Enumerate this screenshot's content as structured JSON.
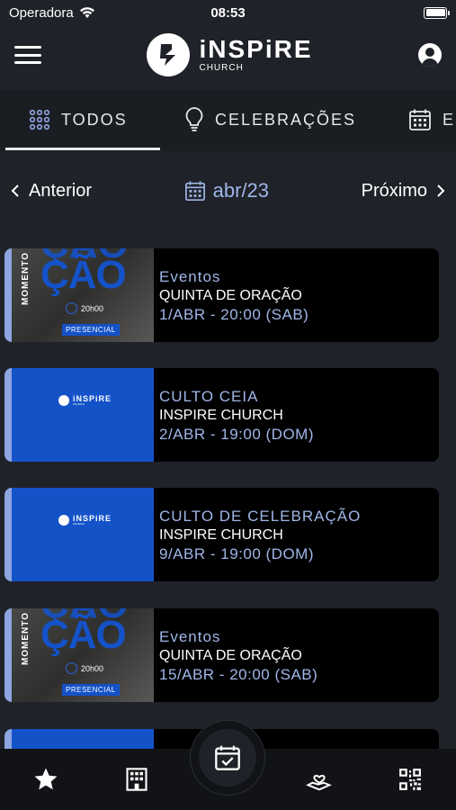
{
  "status": {
    "carrier": "Operadora",
    "time": "08:53"
  },
  "header": {
    "logo_title": "iNSPiRE",
    "logo_subtitle": "CHURCH"
  },
  "tabs": [
    {
      "label": "TODOS",
      "icon": "grid-dots-icon",
      "active": true
    },
    {
      "label": "CELEBRAÇÕES",
      "icon": "lightbulb-icon",
      "active": false
    },
    {
      "label": "E",
      "icon": "calendar-icon",
      "active": false
    }
  ],
  "month_nav": {
    "prev_label": "Anterior",
    "month": "abr/23",
    "next_label": "Próximo"
  },
  "events": [
    {
      "category": "Eventos",
      "title": "QUINTA DE ORAÇÃO",
      "date": "1/ABR - 20:00 (SAB)",
      "thumb": "photo",
      "thumb_text": {
        "big": "ÇÃO",
        "side": "MOMENTO",
        "time": "20h00",
        "badge": "PRESENCIAL"
      }
    },
    {
      "category": "CULTO CEIA",
      "title": "INSPIRE CHURCH",
      "date": "2/ABR - 19:00 (DOM)",
      "thumb": "logo",
      "thumb_text": {
        "logo_title": "iNSPiRE",
        "logo_sub": "CHURCH"
      }
    },
    {
      "category": "CULTO DE CELEBRAÇÃO",
      "title": "INSPIRE CHURCH",
      "date": "9/ABR - 19:00 (DOM)",
      "thumb": "logo",
      "thumb_text": {
        "logo_title": "iNSPiRE",
        "logo_sub": "CHURCH"
      }
    },
    {
      "category": "Eventos",
      "title": "QUINTA DE ORAÇÃO",
      "date": "15/ABR - 20:00 (SAB)",
      "thumb": "photo",
      "thumb_text": {
        "big": "ÇÃO",
        "side": "MOMENTO",
        "time": "20h00",
        "badge": "PRESENCIAL"
      }
    }
  ],
  "bottom_nav": [
    {
      "icon": "star-icon"
    },
    {
      "icon": "building-icon"
    },
    {
      "icon": "calendar-check-icon",
      "active": true
    },
    {
      "icon": "hand-heart-icon"
    },
    {
      "icon": "qr-code-icon"
    }
  ],
  "colors": {
    "background": "#1f2228",
    "accent": "#9fb6e8",
    "brand_blue": "#1452c8"
  }
}
